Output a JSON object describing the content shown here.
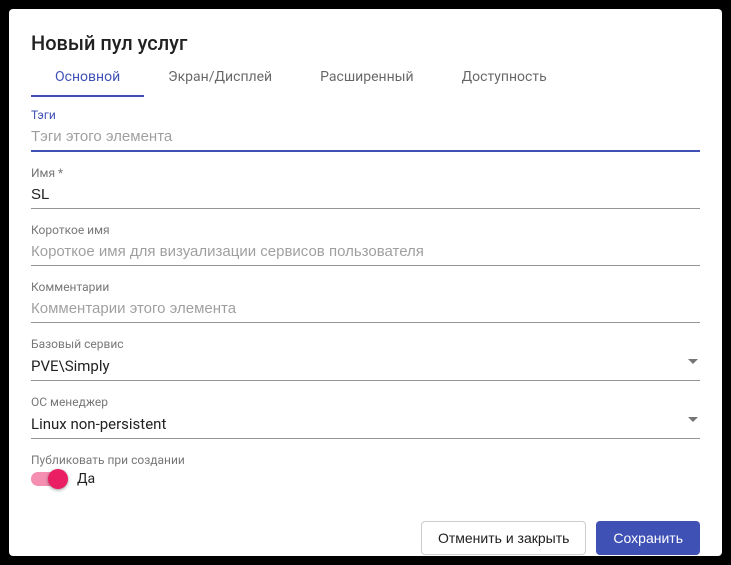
{
  "dialog": {
    "title": "Новый пул услуг"
  },
  "tabs": [
    {
      "label": "Основной",
      "active": true
    },
    {
      "label": "Экран/Дисплей",
      "active": false
    },
    {
      "label": "Расширенный",
      "active": false
    },
    {
      "label": "Доступность",
      "active": false
    }
  ],
  "fields": {
    "tags": {
      "label": "Тэги",
      "value": "",
      "placeholder": "Тэги этого элемента"
    },
    "name": {
      "label": "Имя *",
      "value": "SL",
      "placeholder": ""
    },
    "short_name": {
      "label": "Короткое имя",
      "value": "",
      "placeholder": "Короткое имя для визуализации сервисов пользователя"
    },
    "comments": {
      "label": "Комментарии",
      "value": "",
      "placeholder": "Комментарии этого элемента"
    },
    "base_service": {
      "label": "Базовый сервис",
      "value": "PVE\\Simply"
    },
    "os_manager": {
      "label": "ОС менеджер",
      "value": "Linux non-persistent"
    },
    "publish": {
      "label": "Публиковать при создании",
      "value_label": "Да",
      "on": true
    }
  },
  "buttons": {
    "cancel": "Отменить и закрыть",
    "save": "Сохранить"
  }
}
